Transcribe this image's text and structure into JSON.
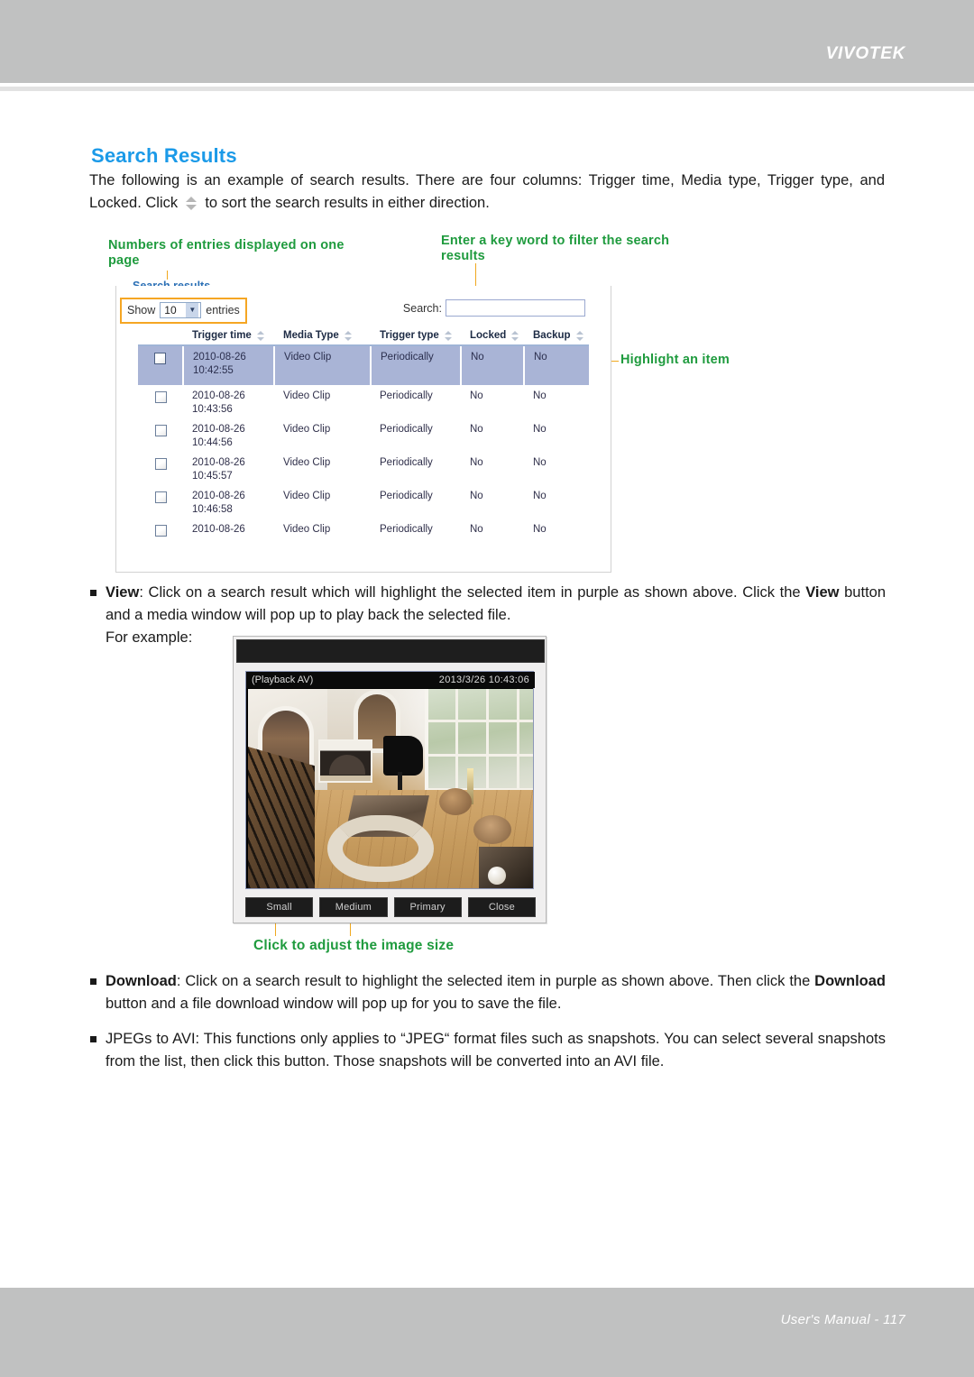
{
  "header": {
    "brand": "VIVOTEK"
  },
  "footer": {
    "text": "User's Manual - 117"
  },
  "section": {
    "title": "Search Results",
    "intro_before": "The following is an example of search results. There are four columns: Trigger time, Media type, Trigger type, and Locked. Click",
    "intro_after": "to sort the search results in either direction."
  },
  "callouts": {
    "entries": "Numbers of entries displayed on one page",
    "filter": "Enter a key word to filter the search results",
    "highlight": "Highlight an item",
    "image_size": "Click to adjust the image size"
  },
  "panel": {
    "legend": "Search results",
    "show_label": "Show",
    "show_value": "10",
    "entries_label": "entries",
    "search_label": "Search:",
    "search_value": "",
    "search_placeholder": ""
  },
  "table": {
    "columns": [
      "",
      "Trigger time",
      "Media Type",
      "Trigger type",
      "Locked",
      "Backup"
    ],
    "rows": [
      {
        "date": "2010-08-26",
        "time": "10:42:55",
        "media": "Video Clip",
        "trigger": "Periodically",
        "locked": "No",
        "backup": "No",
        "selected": true
      },
      {
        "date": "2010-08-26",
        "time": "10:43:56",
        "media": "Video Clip",
        "trigger": "Periodically",
        "locked": "No",
        "backup": "No",
        "selected": false
      },
      {
        "date": "2010-08-26",
        "time": "10:44:56",
        "media": "Video Clip",
        "trigger": "Periodically",
        "locked": "No",
        "backup": "No",
        "selected": false
      },
      {
        "date": "2010-08-26",
        "time": "10:45:57",
        "media": "Video Clip",
        "trigger": "Periodically",
        "locked": "No",
        "backup": "No",
        "selected": false
      },
      {
        "date": "2010-08-26",
        "time": "10:46:58",
        "media": "Video Clip",
        "trigger": "Periodically",
        "locked": "No",
        "backup": "No",
        "selected": false
      },
      {
        "date": "2010-08-26",
        "time": "",
        "media": "Video Clip",
        "trigger": "Periodically",
        "locked": "No",
        "backup": "No",
        "selected": false
      }
    ]
  },
  "player": {
    "osd_label": "(Playback AV)",
    "osd_timestamp": "2013/3/26 10:43:06",
    "buttons": [
      "Small",
      "Medium",
      "Primary",
      "Close"
    ]
  },
  "bullets": {
    "view": "View: Click on a search result which will highlight the selected item in purple as shown above. Click the View button and a media window will pop up to play back the selected file.",
    "view_example": "For example:",
    "view_bold": "View",
    "download": "Download: Click on a search result to highlight the selected item in purple as shown above. Then click the Download button and a file download window will pop up for you to save the file.",
    "download_bold": "Download",
    "jpegs": "JPEGs to AVI: This functions only applies to “JPEG“ format files such as snapshots. You can select several snapshots from the list, then click this button. Those snapshots will be converted into an AVI file."
  },
  "colors": {
    "accent_blue": "#1b9ae8",
    "callout_green": "#1f9b3e",
    "highlight_row": "#a9b4d6",
    "leader_orange": "#f0a81e",
    "header_gray": "#c0c1c1"
  }
}
